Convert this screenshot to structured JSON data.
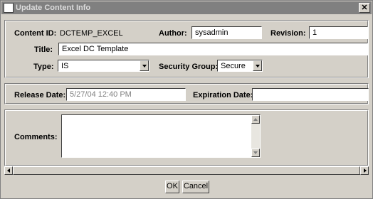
{
  "window": {
    "title": "Update Content Info"
  },
  "content_id": {
    "label": "Content ID:",
    "value": "DCTEMP_EXCEL"
  },
  "author": {
    "label": "Author:",
    "value": "sysadmin"
  },
  "revision": {
    "label": "Revision:",
    "value": "1"
  },
  "title": {
    "label": "Title:",
    "value": "Excel DC Template"
  },
  "type": {
    "label": "Type:",
    "value": "IS"
  },
  "security_group": {
    "label": "Security Group:",
    "value": "Secure"
  },
  "release_date": {
    "label": "Release Date:",
    "value": "5/27/04 12:40 PM"
  },
  "expiration_date": {
    "label": "Expiration Date:",
    "value": ""
  },
  "comments": {
    "label": "Comments:",
    "value": ""
  },
  "buttons": {
    "ok": "OK",
    "cancel": "Cancel"
  }
}
